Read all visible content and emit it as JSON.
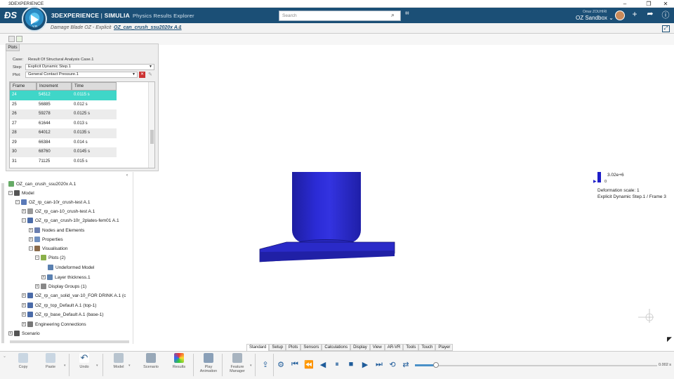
{
  "window": {
    "title": "3DEXPERIENCE",
    "controls": [
      "–",
      "❐",
      "✕"
    ]
  },
  "appbar": {
    "brand_bold": "3DEXPERIENCE",
    "brand_sep": " | ",
    "brand_company": "SIMULIA",
    "app_name": "Physics Results Explorer",
    "search_placeholder": "Search",
    "user_name": "Omar ZOUHIRI",
    "sandbox": "OZ Sandbox ⌄",
    "compass_label": "V,R"
  },
  "tabs": [
    {
      "label": "Damage Blade OZ - Explicit"
    },
    {
      "label": "OZ_can_crush_ssu2020x A.1",
      "active": true
    }
  ],
  "plots": {
    "tab": "Plots",
    "case_label": "Case:",
    "case_value": "Result Of Structural Analysis Case.1",
    "step_label": "Step:",
    "step_value": "Explicit Dynamic Step.1",
    "plot_label": "Plot:",
    "plot_value": "General Contact Pressure.1",
    "columns": [
      "Frame",
      "Increment",
      "Time"
    ],
    "rows": [
      [
        "24",
        "54512",
        "0.0115 s"
      ],
      [
        "25",
        "56885",
        "0.012 s"
      ],
      [
        "26",
        "59278",
        "0.0125 s"
      ],
      [
        "27",
        "61644",
        "0.013 s"
      ],
      [
        "28",
        "64012",
        "0.0135 s"
      ],
      [
        "29",
        "66384",
        "0.014 s"
      ],
      [
        "30",
        "68760",
        "0.0145 s"
      ],
      [
        "31",
        "71125",
        "0.015 s"
      ]
    ]
  },
  "tree": {
    "root": "OZ_can_crush_ssu2020x A.1",
    "items": [
      {
        "label": "Model"
      },
      {
        "label": "OZ_rp_can-10r_crush-test A.1"
      },
      {
        "label": "OZ_rp_can-10_crush-test A.1"
      },
      {
        "label": "OZ_rp_can_crush-10r_2plates-fem01 A.1"
      },
      {
        "label": "Nodes and Elements"
      },
      {
        "label": "Properties"
      },
      {
        "label": "Visualisation"
      },
      {
        "label": "Plots (2)"
      },
      {
        "label": "Undeformed Model"
      },
      {
        "label": "Layer thickness.1"
      },
      {
        "label": "Display Groups (1)"
      },
      {
        "label": "OZ_rp_can_solid_var-10_FOR DRINK A.1 (c"
      },
      {
        "label": "OZ_rp_top_Default A.1 (top-1)"
      },
      {
        "label": "OZ_rp_base_Default A.1 (base-1)"
      },
      {
        "label": "Engineering Connections"
      },
      {
        "label": "Scenario"
      }
    ]
  },
  "legend": {
    "max": "3.02e+6",
    "min": "0",
    "deformation": "Deformation scale: 1",
    "frame": "Explicit Dynamic Step.1 / Frame 3"
  },
  "bottom_tabs": [
    "Standard",
    "Setup",
    "Plots",
    "Sensors",
    "Calculations",
    "Display",
    "View",
    "AR-VR",
    "Tools",
    "Touch",
    "Player"
  ],
  "toolbar": {
    "copy": "Copy",
    "paste": "Paste",
    "undo": "Undo",
    "model": "Model",
    "scenario": "Scenario",
    "results": "Results",
    "play_animation_1": "Play",
    "play_animation_2": "Animation",
    "feature_1": "Feature",
    "feature_2": "Manager",
    "time_value": "0.002 s"
  }
}
